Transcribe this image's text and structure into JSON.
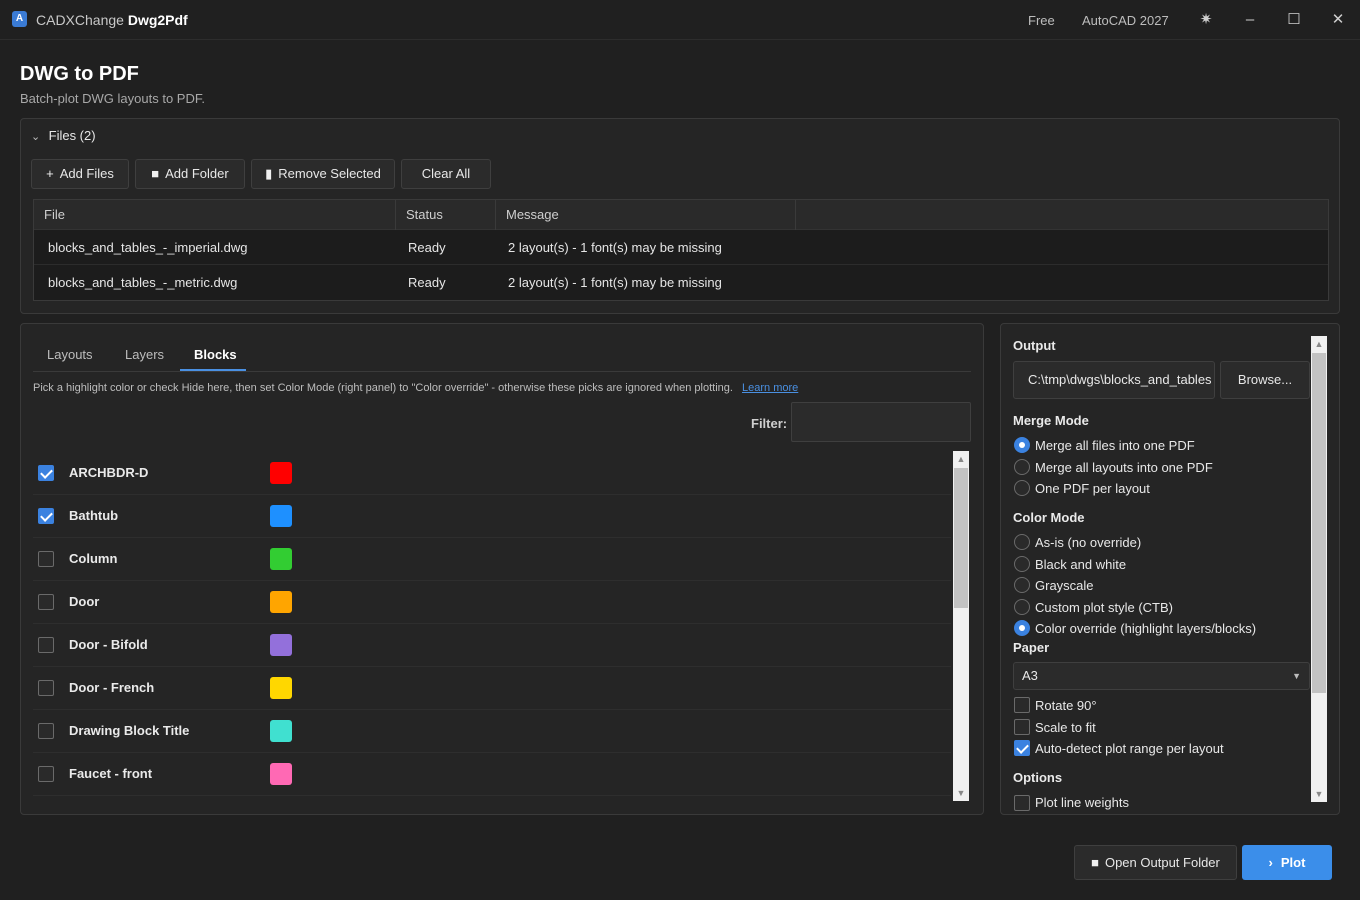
{
  "titlebar": {
    "app_name": "CADXChange",
    "app_product": "Dwg2Pdf",
    "plan": "Free",
    "autocad_version": "AutoCAD 2027"
  },
  "header": {
    "title": "DWG to PDF",
    "subtitle": "Batch-plot DWG layouts to PDF."
  },
  "files": {
    "header": "Files (2)",
    "buttons": {
      "add_files": "Add Files",
      "add_folder": "Add Folder",
      "remove_selected": "Remove Selected",
      "clear_all": "Clear All"
    },
    "columns": [
      "File",
      "Status",
      "Message"
    ],
    "rows": [
      {
        "file": "blocks_and_tables_-_imperial.dwg",
        "status": "Ready",
        "message": "2 layout(s) - 1 font(s) may be missing"
      },
      {
        "file": "blocks_and_tables_-_metric.dwg",
        "status": "Ready",
        "message": "2 layout(s) - 1 font(s) may be missing"
      }
    ]
  },
  "tabs": {
    "layouts": "Layouts",
    "layers": "Layers",
    "blocks": "Blocks",
    "active": "Blocks"
  },
  "blocks_panel": {
    "hint": "Pick a highlight color or check Hide here, then set Color Mode (right panel) to \"Color override\" - otherwise these picks are ignored when plotting.",
    "learn_more": "Learn more",
    "filter_label": "Filter:",
    "filter_value": "",
    "items": [
      {
        "name": "ARCHBDR-D",
        "checked": true,
        "color": "#ff0000"
      },
      {
        "name": "Bathtub",
        "checked": true,
        "color": "#1e90ff"
      },
      {
        "name": "Column",
        "checked": false,
        "color": "#32cd32"
      },
      {
        "name": "Door",
        "checked": false,
        "color": "#ffa500"
      },
      {
        "name": "Door - Bifold",
        "checked": false,
        "color": "#9370db"
      },
      {
        "name": "Door - French",
        "checked": false,
        "color": "#ffd700"
      },
      {
        "name": "Drawing Block Title",
        "checked": false,
        "color": "#40e0d0"
      },
      {
        "name": "Faucet - front",
        "checked": false,
        "color": "#ff69b4"
      }
    ]
  },
  "output": {
    "title": "Output",
    "path": "C:\\tmp\\dwgs\\blocks_and_tables",
    "browse": "Browse...",
    "merge_mode": {
      "title": "Merge Mode",
      "options": [
        "Merge all files into one PDF",
        "Merge all layouts into one PDF",
        "One PDF per layout"
      ],
      "selected": 0
    },
    "color_mode": {
      "title": "Color Mode",
      "options": [
        "As-is (no override)",
        "Black and white",
        "Grayscale",
        "Custom plot style (CTB)",
        "Color override (highlight layers/blocks)"
      ],
      "selected": 4
    },
    "paper": {
      "title": "Paper",
      "value": "A3"
    },
    "paper_checks": [
      {
        "label": "Rotate 90°",
        "checked": false
      },
      {
        "label": "Scale to fit",
        "checked": false
      },
      {
        "label": "Auto-detect plot range per layout",
        "checked": true
      }
    ],
    "options": {
      "title": "Options",
      "partial_item": "Plot line weights"
    }
  },
  "actions": {
    "open_output_folder": "Open Output Folder",
    "plot": "Plot"
  },
  "colors": {
    "accent": "#3b8eea",
    "background": "#202020",
    "panel": "#252525"
  }
}
